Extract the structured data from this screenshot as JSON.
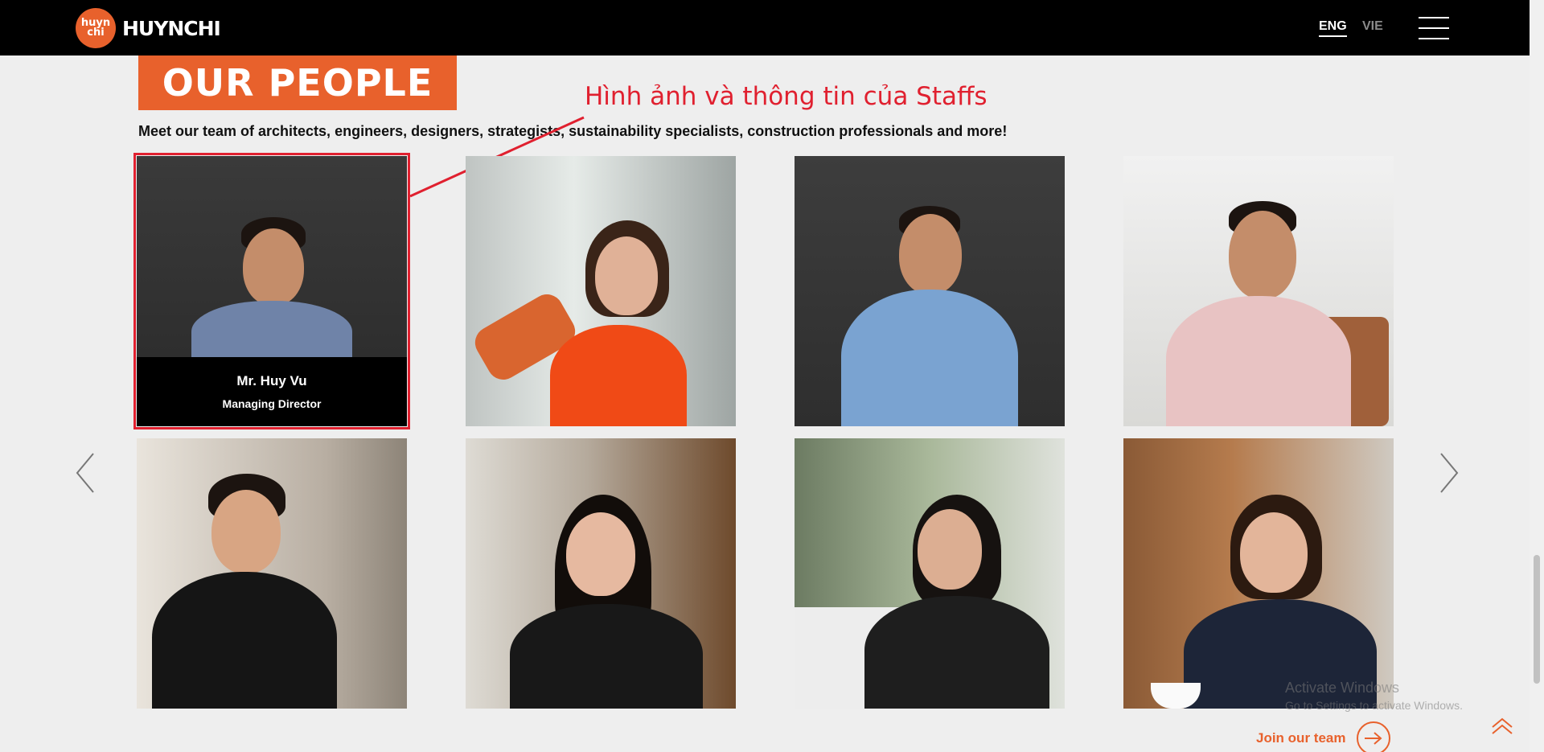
{
  "header": {
    "logo_mark_top": "huyn",
    "logo_mark_bottom": "chi",
    "logo_text": "HUYNCHI",
    "lang_en": "ENG",
    "lang_vi": "VIE",
    "menu_icon": "hamburger-icon"
  },
  "section": {
    "title": "OUR PEOPLE",
    "annotation": "Hình ảnh và thông tin của Staffs",
    "subtitle": "Meet our team of architects, engineers, designers, strategists, sustainability specialists, construction professionals and more!"
  },
  "staff": [
    {
      "name": "Mr. Huy Vu",
      "role": "Managing Director"
    }
  ],
  "footer": {
    "join_label": "Join our team",
    "watermark_title": "Activate Windows",
    "watermark_sub": "Go to Settings to activate Windows."
  },
  "colors": {
    "brand_orange": "#e8612c",
    "annotation_red": "#e0202f"
  }
}
